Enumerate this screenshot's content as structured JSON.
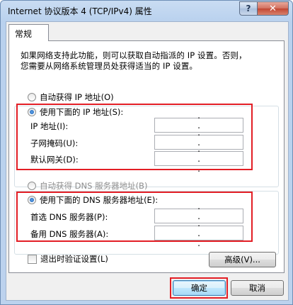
{
  "window": {
    "title": "Internet 协议版本 4 (TCP/IPv4) 属性",
    "help_glyph": "?",
    "close_glyph": "✕"
  },
  "tab": {
    "label": "常规"
  },
  "description": {
    "line1": "如果网络支持此功能，则可以获取自动指派的 IP 设置。否则，",
    "line2": "您需要从网络系统管理员处获得适当的 IP 设置。"
  },
  "ip_section": {
    "auto_label": "自动获得 IP 地址(O)",
    "manual_label": "使用下面的 IP 地址(S):",
    "fields": [
      {
        "label": "IP 地址(I):",
        "value": ". . ."
      },
      {
        "label": "子网掩码(U):",
        "value": ". . ."
      },
      {
        "label": "默认网关(D):",
        "value": ". . ."
      }
    ]
  },
  "dns_section": {
    "auto_label": "自动获得 DNS 服务器地址(B)",
    "manual_label": "使用下面的 DNS 服务器地址(E):",
    "fields": [
      {
        "label": "首选 DNS 服务器(P):",
        "value": ". . ."
      },
      {
        "label": "备用 DNS 服务器(A):",
        "value": ". . ."
      }
    ]
  },
  "validate_label": "退出时验证设置(L)",
  "advanced_label": "高级(V)...",
  "ok_label": "确定",
  "cancel_label": "取消",
  "colors": {
    "highlight": "#e31e25",
    "title_bar": "#b9d1ee"
  }
}
